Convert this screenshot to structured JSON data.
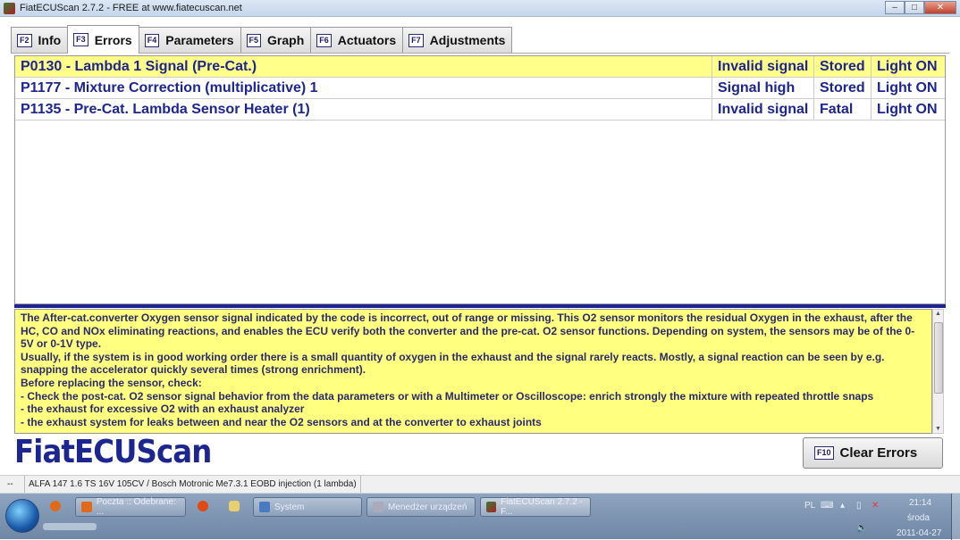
{
  "window": {
    "title": "FiatECUScan 2.7.2 - FREE at www.fiatecuscan.net"
  },
  "tabs": [
    {
      "key": "F2",
      "label": "Info"
    },
    {
      "key": "F3",
      "label": "Errors",
      "active": true
    },
    {
      "key": "F4",
      "label": "Parameters"
    },
    {
      "key": "F5",
      "label": "Graph"
    },
    {
      "key": "F6",
      "label": "Actuators"
    },
    {
      "key": "F7",
      "label": "Adjustments"
    }
  ],
  "errors": [
    {
      "code": "P0130 - Lambda 1 Signal (Pre-Cat.)",
      "type": "Invalid signal",
      "state": "Stored",
      "light": "Light ON",
      "selected": true
    },
    {
      "code": "P1177 - Mixture Correction (multiplicative) 1",
      "type": "Signal high",
      "state": "Stored",
      "light": "Light ON"
    },
    {
      "code": "P1135 - Pre-Cat. Lambda Sensor Heater (1)",
      "type": "Invalid signal",
      "state": "Fatal",
      "light": "Light ON"
    }
  ],
  "description": [
    "The After-cat.converter Oxygen sensor signal indicated by the code is incorrect, out of range or missing. This O2 sensor monitors the residual Oxygen in the exhaust, after the HC, CO and NOx eliminating reactions, and enables the ECU verify both the converter and the pre-cat. O2 sensor functions. Depending on system, the sensors may be of the 0-5V or 0-1V type.",
    "Usually, if the system is in good working order there is a small quantity of oxygen in the exhaust and the signal rarely reacts. Mostly, a signal reaction can be seen by e.g. snapping the accelerator quickly several times (strong enrichment).",
    "Before replacing the sensor, check:",
    "- Check the post-cat. O2 sensor signal behavior from the data parameters or with a Multimeter or Oscilloscope: enrich strongly the mixture with repeated throttle snaps",
    "- the exhaust for excessive O2 with an exhaust analyzer",
    "- the exhaust system for leaks between and near the O2 sensors and at the converter to exhaust joints"
  ],
  "logo": "FiatECUScan",
  "clear_button": {
    "key": "F10",
    "label": "Clear Errors"
  },
  "status": {
    "left": "--",
    "vehicle": "ALFA 147 1.6 TS 16V 105CV / Bosch Motronic Me7.3.1 EOBD injection (1 lambda)"
  },
  "taskbar": {
    "buttons": [
      "Poczta :: Odebrane: ...",
      "System",
      "Menedżer urządzeń",
      "FiatECUScan 2.7.2 - F..."
    ],
    "lang": "PL",
    "time": "21:14",
    "day": "środa",
    "date": "2011-04-27"
  },
  "colors": {
    "accent": "#1c2590",
    "highlight": "#ffff8a",
    "desc_bg": "#ffff80"
  }
}
